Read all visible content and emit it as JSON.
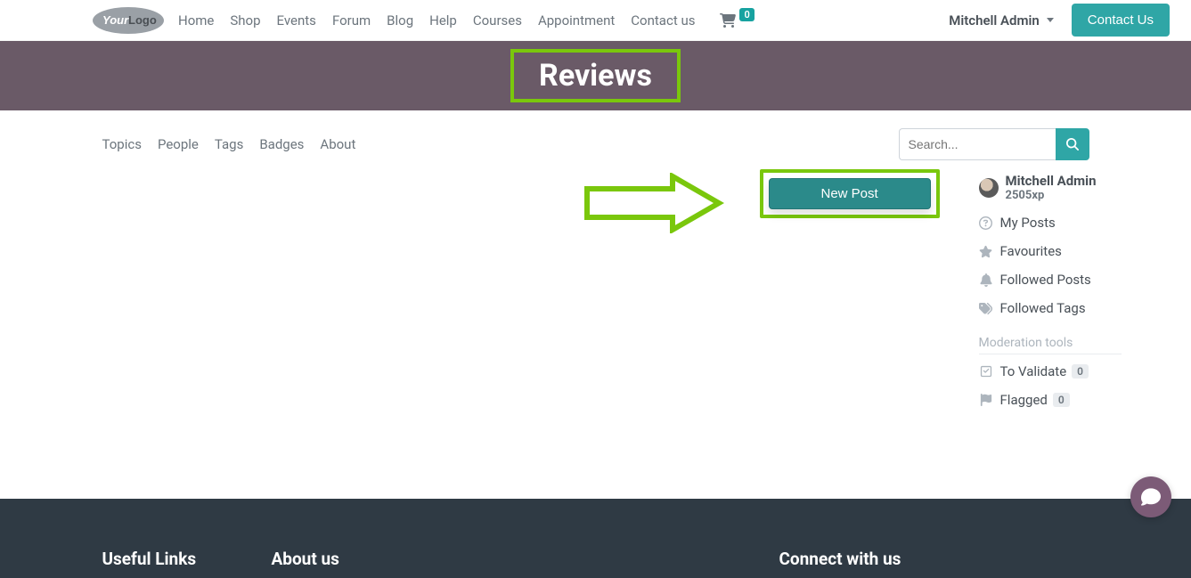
{
  "nav": {
    "links": [
      "Home",
      "Shop",
      "Events",
      "Forum",
      "Blog",
      "Help",
      "Courses",
      "Appointment",
      "Contact us"
    ],
    "cart_count": "0",
    "user_name": "Mitchell Admin",
    "contact_btn": "Contact Us"
  },
  "hero": {
    "title": "Reviews"
  },
  "subnav": {
    "links": [
      "Topics",
      "People",
      "Tags",
      "Badges",
      "About"
    ],
    "search_placeholder": "Search..."
  },
  "actions": {
    "new_post": "New Post"
  },
  "sidebar": {
    "user_name": "Mitchell Admin",
    "user_xp": "2505xp",
    "items": {
      "my_posts": "My Posts",
      "favourites": "Favourites",
      "followed_posts": "Followed Posts",
      "followed_tags": "Followed Tags"
    },
    "moderation_title": "Moderation tools",
    "moderation": {
      "to_validate": "To Validate",
      "to_validate_count": "0",
      "flagged": "Flagged",
      "flagged_count": "0"
    }
  },
  "footer": {
    "useful": "Useful Links",
    "about": "About us",
    "connect": "Connect with us"
  }
}
